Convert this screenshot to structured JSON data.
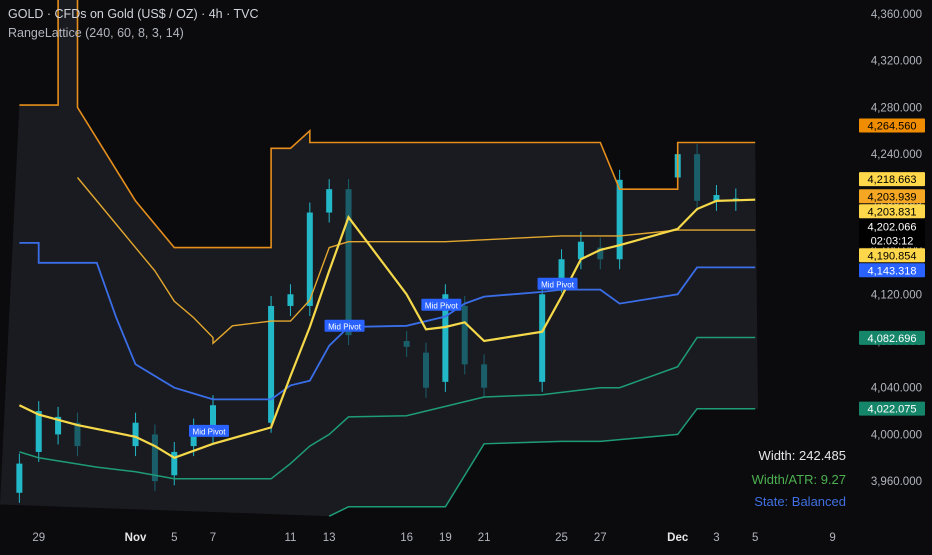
{
  "header": {
    "symbol_line": "GOLD · CFDs on Gold (US$ / OZ) · 4h · TVC",
    "indicator_line": "RangeLattice (240, 60, 8, 3, 14)"
  },
  "stats": {
    "width": "Width: 242.485",
    "width_atr": "Width/ATR: 9.27",
    "state": "State: Balanced"
  },
  "colors": {
    "background": "#0b0b0d",
    "band_fill": "#1c1d22",
    "candle_up": "#22b8c8",
    "candle_down": "#1a5e6a",
    "outer_band": "#e68e1c",
    "inner_band": "#e2a72e",
    "mid_line": "#3a6ee8",
    "lower_band": "#1e9c78",
    "ma_line": "#f5d94a",
    "stat_width": "#e6e6e6",
    "stat_atr": "#4caf50",
    "stat_state": "#3f6fe0"
  },
  "chart_data": {
    "type": "line",
    "title": "GOLD · CFDs on Gold (US$ / OZ) · 4h · TVC",
    "y_axis": {
      "ylim": [
        3925,
        4372
      ],
      "ticks": [
        3960,
        4000,
        4040,
        4080,
        4120,
        4160,
        4200,
        4240,
        4280,
        4320,
        4360
      ],
      "tick_labels": [
        "3,960.000",
        "4,000.000",
        "4,040.000",
        "4,080.000",
        "4,120.000",
        "4,160.000",
        "4,200.000",
        "4,240.000",
        "4,280.000",
        "4,320.000",
        "4,360.000"
      ]
    },
    "x_axis": {
      "tick_labels": [
        "29",
        "Nov",
        "5",
        "7",
        "11",
        "13",
        "16",
        "19",
        "21",
        "25",
        "27",
        "Dec",
        "3",
        "5",
        "9"
      ],
      "tick_dates": [
        "2025-10-29",
        "2025-11-03",
        "2025-11-05",
        "2025-11-07",
        "2025-11-11",
        "2025-11-13",
        "2025-11-17",
        "2025-11-19",
        "2025-11-21",
        "2025-11-25",
        "2025-11-27",
        "2025-12-01",
        "2025-12-03",
        "2025-12-05",
        "2025-12-09"
      ]
    },
    "price_labels": [
      {
        "value": "4,264.560",
        "color": "#f08c00",
        "text_color": "#000000"
      },
      {
        "value": "4,218.663",
        "color": "#ffd74a",
        "text_color": "#000000"
      },
      {
        "value": "4,203.939",
        "color": "#f5a623",
        "text_color": "#000000"
      },
      {
        "value": "4,203.831",
        "color": "#ffd74a",
        "text_color": "#000000"
      },
      {
        "value": "4,202.066",
        "color": "#000000",
        "text_color": "#ffffff",
        "sub": "02:03:12"
      },
      {
        "value": "4,190.854",
        "color": "#ffd74a",
        "text_color": "#000000"
      },
      {
        "value": "4,143.318",
        "color": "#2962ff",
        "text_color": "#ffffff"
      },
      {
        "value": "4,082.696",
        "color": "#16866a",
        "text_color": "#ffffff"
      },
      {
        "value": "4,022.075",
        "color": "#16866a",
        "text_color": "#ffffff"
      }
    ],
    "pivot_labels": [
      {
        "text": "Mid Pivot",
        "date": "2025-11-07",
        "value": 4003
      },
      {
        "text": "Mid Pivot",
        "date": "2025-11-14",
        "value": 4093
      },
      {
        "text": "Mid Pivot",
        "date": "2025-11-19",
        "value": 4111
      },
      {
        "text": "Mid Pivot",
        "date": "2025-11-25",
        "value": 4129
      }
    ],
    "series": [
      {
        "key": "outer_upper",
        "x": [
          "2025-10-28",
          "2025-10-30",
          "2025-10-30",
          "2025-10-31",
          "2025-10-31",
          "2025-11-03",
          "2025-11-05",
          "2025-11-06",
          "2025-11-07",
          "2025-11-10",
          "2025-11-10",
          "2025-11-11",
          "2025-11-12",
          "2025-11-12",
          "2025-11-13",
          "2025-11-19",
          "2025-11-25",
          "2025-11-27",
          "2025-11-28",
          "2025-12-01",
          "2025-12-01",
          "2025-12-05"
        ],
        "values": [
          4282,
          4282,
          4379,
          4379,
          4280,
          4200,
          4160,
          4160,
          4160,
          4160,
          4245,
          4245,
          4260,
          4250,
          4250,
          4250,
          4250,
          4250,
          4210,
          4210,
          4250,
          4250
        ]
      },
      {
        "key": "inner_upper",
        "x": [
          "2025-10-31",
          "2025-11-03",
          "2025-11-04",
          "2025-11-05",
          "2025-11-06",
          "2025-11-07",
          "2025-11-07",
          "2025-11-08",
          "2025-11-10",
          "2025-11-11",
          "2025-11-12",
          "2025-11-13",
          "2025-11-14",
          "2025-11-19",
          "2025-11-25",
          "2025-11-28",
          "2025-12-01",
          "2025-12-05"
        ],
        "values": [
          4220,
          4160,
          4140,
          4114,
          4100,
          4083,
          4078,
          4093,
          4097,
          4097,
          4115,
          4160,
          4165,
          4165,
          4170,
          4170,
          4175,
          4175
        ]
      },
      {
        "key": "mid",
        "x": [
          "2025-10-28",
          "2025-10-29",
          "2025-10-29",
          "2025-11-01",
          "2025-11-02",
          "2025-11-03",
          "2025-11-05",
          "2025-11-06",
          "2025-11-07",
          "2025-11-10",
          "2025-11-11",
          "2025-11-12",
          "2025-11-13",
          "2025-11-14",
          "2025-11-17",
          "2025-11-19",
          "2025-11-20",
          "2025-11-21",
          "2025-11-24",
          "2025-11-25",
          "2025-11-27",
          "2025-11-28",
          "2025-12-01",
          "2025-12-02",
          "2025-12-05"
        ],
        "values": [
          4164,
          4164,
          4147,
          4147,
          4100,
          4060,
          4040,
          4035,
          4030,
          4030,
          4042,
          4046,
          4076,
          4092,
          4093,
          4101,
          4112,
          4118,
          4122,
          4124,
          4124,
          4112,
          4120,
          4143,
          4143
        ]
      },
      {
        "key": "lower_inner",
        "x": [
          "2025-10-28",
          "2025-10-29",
          "2025-11-01",
          "2025-11-03",
          "2025-11-05",
          "2025-11-06",
          "2025-11-07",
          "2025-11-10",
          "2025-11-11",
          "2025-11-12",
          "2025-11-13",
          "2025-11-14",
          "2025-11-17",
          "2025-11-19",
          "2025-11-21",
          "2025-11-24",
          "2025-11-25",
          "2025-11-27",
          "2025-11-28",
          "2025-12-01",
          "2025-12-02",
          "2025-12-05"
        ],
        "values": [
          3985,
          3980,
          3972,
          3968,
          3962,
          3962,
          3962,
          3962,
          3975,
          3990,
          4000,
          4015,
          4016,
          4024,
          4032,
          4034,
          4036,
          4040,
          4040,
          4058,
          4083,
          4083
        ]
      },
      {
        "key": "lower_outer",
        "x": [
          "2025-11-13",
          "2025-11-14",
          "2025-11-19",
          "2025-11-21",
          "2025-11-25",
          "2025-11-27",
          "2025-12-01",
          "2025-12-02",
          "2025-12-05"
        ],
        "values": [
          3930,
          3938,
          3938,
          3992,
          3994,
          3994,
          4000,
          4022,
          4022
        ]
      },
      {
        "key": "ma",
        "x": [
          "2025-10-28",
          "2025-10-29",
          "2025-10-31",
          "2025-11-03",
          "2025-11-04",
          "2025-11-05",
          "2025-11-06",
          "2025-11-07",
          "2025-11-10",
          "2025-11-11",
          "2025-11-12",
          "2025-11-13",
          "2025-11-14",
          "2025-11-17",
          "2025-11-18",
          "2025-11-19",
          "2025-11-20",
          "2025-11-21",
          "2025-11-24",
          "2025-11-25",
          "2025-11-26",
          "2025-11-27",
          "2025-11-28",
          "2025-12-01",
          "2025-12-02",
          "2025-12-03",
          "2025-12-05"
        ],
        "values": [
          4025,
          4017,
          4008,
          3998,
          3990,
          3980,
          3986,
          3992,
          4006,
          4050,
          4092,
          4140,
          4186,
          4120,
          4090,
          4092,
          4096,
          4080,
          4088,
          4118,
          4150,
          4158,
          4162,
          4176,
          4193,
          4200,
          4201
        ]
      }
    ],
    "candles": [
      {
        "date": "2025-10-28",
        "open": 3950,
        "close": 3975
      },
      {
        "date": "2025-10-29",
        "open": 3985,
        "close": 4020
      },
      {
        "date": "2025-10-30",
        "open": 4000,
        "close": 4015
      },
      {
        "date": "2025-10-31",
        "open": 4010,
        "close": 3990
      },
      {
        "date": "2025-11-03",
        "open": 3990,
        "close": 4010
      },
      {
        "date": "2025-11-04",
        "open": 4000,
        "close": 3960
      },
      {
        "date": "2025-11-05",
        "open": 3965,
        "close": 3985
      },
      {
        "date": "2025-11-06",
        "open": 3990,
        "close": 4005
      },
      {
        "date": "2025-11-07",
        "open": 4000,
        "close": 4025
      },
      {
        "date": "2025-11-10",
        "open": 4010,
        "close": 4110
      },
      {
        "date": "2025-11-11",
        "open": 4110,
        "close": 4120
      },
      {
        "date": "2025-11-12",
        "open": 4110,
        "close": 4190
      },
      {
        "date": "2025-11-13",
        "open": 4190,
        "close": 4210
      },
      {
        "date": "2025-11-14",
        "open": 4210,
        "close": 4085
      },
      {
        "date": "2025-11-17",
        "open": 4080,
        "close": 4075
      },
      {
        "date": "2025-11-18",
        "open": 4070,
        "close": 4040
      },
      {
        "date": "2025-11-19",
        "open": 4045,
        "close": 4120
      },
      {
        "date": "2025-11-20",
        "open": 4110,
        "close": 4060
      },
      {
        "date": "2025-11-21",
        "open": 4060,
        "close": 4040
      },
      {
        "date": "2025-11-24",
        "open": 4045,
        "close": 4120
      },
      {
        "date": "2025-11-25",
        "open": 4130,
        "close": 4150
      },
      {
        "date": "2025-11-26",
        "open": 4150,
        "close": 4165
      },
      {
        "date": "2025-11-27",
        "open": 4160,
        "close": 4150
      },
      {
        "date": "2025-11-28",
        "open": 4150,
        "close": 4218
      },
      {
        "date": "2025-12-01",
        "open": 4220,
        "close": 4240
      },
      {
        "date": "2025-12-02",
        "open": 4240,
        "close": 4200
      },
      {
        "date": "2025-12-03",
        "open": 4200,
        "close": 4205
      },
      {
        "date": "2025-12-04",
        "open": 4200,
        "close": 4202
      }
    ]
  }
}
